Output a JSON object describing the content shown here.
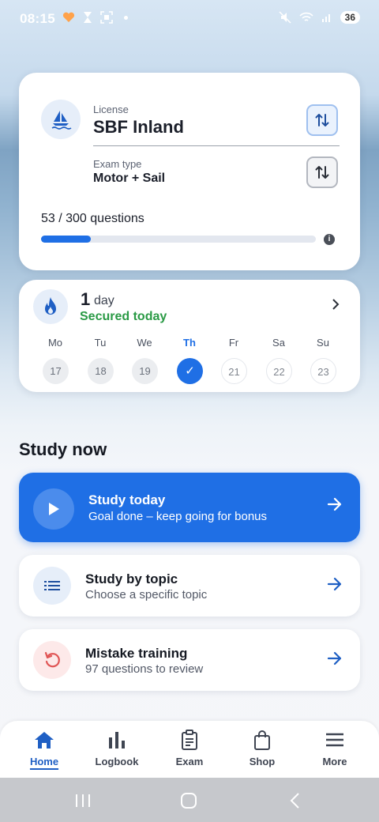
{
  "status_bar": {
    "time": "08:15",
    "battery": "36"
  },
  "license_card": {
    "license_label": "License",
    "license_value": "SBF Inland",
    "exam_type_label": "Exam type",
    "exam_type_value": "Motor + Sail",
    "questions_text": "53 / 300 questions",
    "progress_fraction": 0.18
  },
  "streak": {
    "count": "1",
    "unit": "day",
    "status": "Secured today",
    "days": [
      {
        "label": "Mo",
        "date": "17",
        "state": "past"
      },
      {
        "label": "Tu",
        "date": "18",
        "state": "past"
      },
      {
        "label": "We",
        "date": "19",
        "state": "past"
      },
      {
        "label": "Th",
        "date": "✓",
        "state": "done"
      },
      {
        "label": "Fr",
        "date": "21",
        "state": "future"
      },
      {
        "label": "Sa",
        "date": "22",
        "state": "future"
      },
      {
        "label": "Su",
        "date": "23",
        "state": "future"
      }
    ]
  },
  "study": {
    "section_title": "Study now",
    "items": [
      {
        "title": "Study today",
        "subtitle": "Goal done – keep going for bonus"
      },
      {
        "title": "Study by topic",
        "subtitle": "Choose a specific topic"
      },
      {
        "title": "Mistake training",
        "subtitle": "97 questions to review"
      }
    ]
  },
  "nav": {
    "items": [
      {
        "label": "Home",
        "icon": "home-icon"
      },
      {
        "label": "Logbook",
        "icon": "bar-chart-icon"
      },
      {
        "label": "Exam",
        "icon": "clipboard-icon"
      },
      {
        "label": "Shop",
        "icon": "shopping-bag-icon"
      },
      {
        "label": "More",
        "icon": "menu-icon"
      }
    ]
  },
  "colors": {
    "accent": "#1f6fe5",
    "success": "#2a9a45",
    "mistake": "#e05555"
  }
}
